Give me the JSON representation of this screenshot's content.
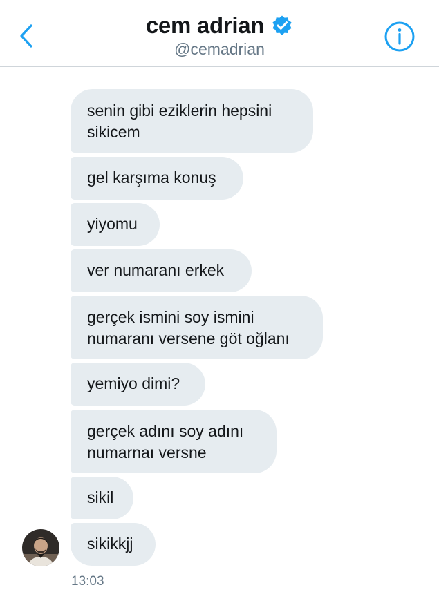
{
  "header": {
    "title": "cem adrian",
    "handle": "@cemadrian",
    "verified": true,
    "back_icon": "chevron-left-icon",
    "info_icon": "info-circle-icon",
    "accent_color": "#1da1f2"
  },
  "messages": [
    {
      "text": "senin gibi eziklerin hepsini\nsikicem"
    },
    {
      "text": "gel karşıma konuş"
    },
    {
      "text": "yiyomu"
    },
    {
      "text": "ver numaranı erkek"
    },
    {
      "text": "gerçek ismini soy ismini\nnumaranı versene göt oğlanı"
    },
    {
      "text": "yemiyo dimi?"
    },
    {
      "text": "gerçek adını soy adını\nnumarnaı versne"
    },
    {
      "text": "sikil"
    },
    {
      "text": "sikikkjj"
    }
  ],
  "conversation": {
    "timestamp": "13:03",
    "bubble_color": "#e6ecf0"
  }
}
